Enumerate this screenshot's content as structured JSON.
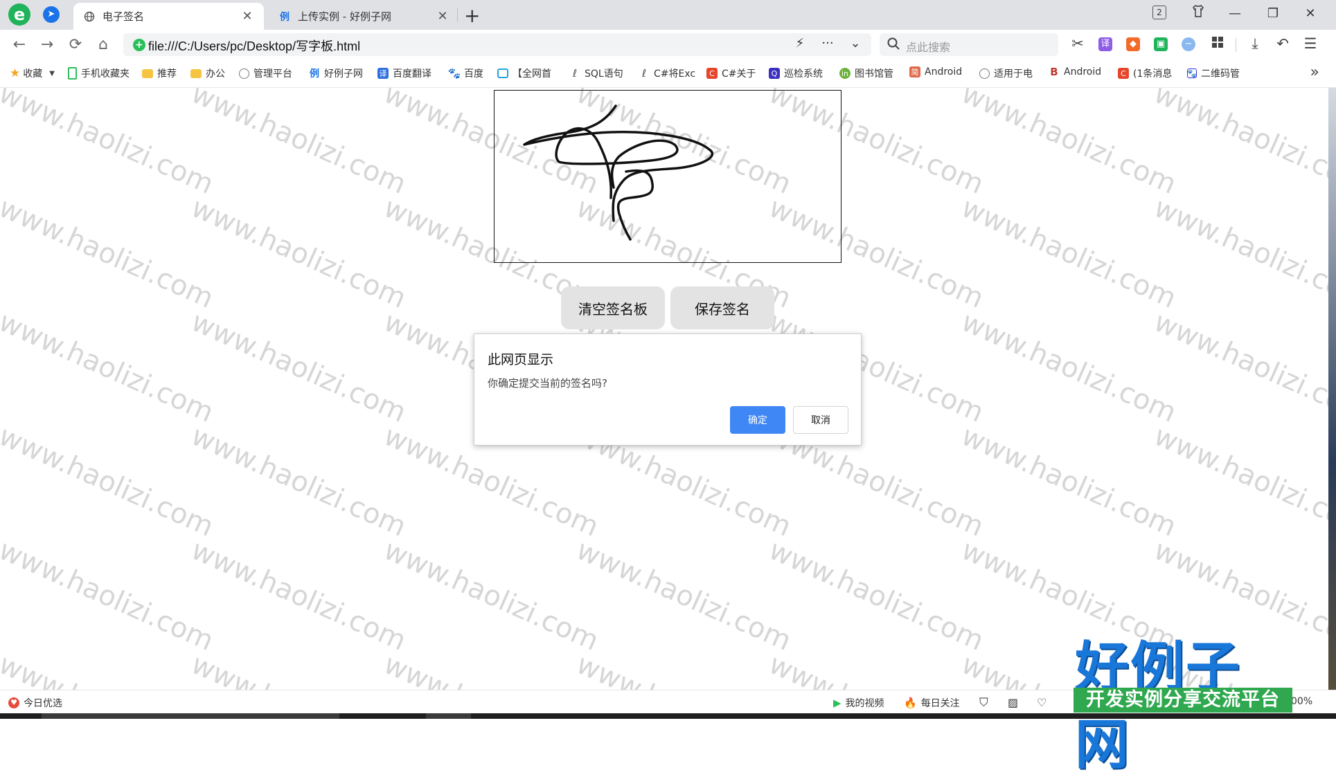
{
  "tabs": [
    {
      "title": "电子签名",
      "active": true
    },
    {
      "title": "上传实例 - 好例子网",
      "active": false,
      "favicon_text": "例"
    }
  ],
  "tab_count": "2",
  "address": {
    "url": "file:///C:/Users/pc/Desktop/写字板.html"
  },
  "search": {
    "placeholder": "点此搜索"
  },
  "bookmarks": [
    {
      "label": "收藏",
      "icon": "star-icon",
      "color": "#f5a623"
    },
    {
      "label": "手机收藏夹",
      "icon": "phone-icon",
      "color": "#2bbf5a"
    },
    {
      "label": "推荐",
      "icon": "folder-icon",
      "color": "#f5c542"
    },
    {
      "label": "办公",
      "icon": "folder-icon",
      "color": "#f5c542"
    },
    {
      "label": "管理平台",
      "icon": "globe-icon",
      "color": "#777777"
    },
    {
      "label": "好例子网",
      "icon": "haolizi-icon",
      "color": "#1a73e8"
    },
    {
      "label": "百度翻译",
      "icon": "translate-icon",
      "color": "#2f6fe0"
    },
    {
      "label": "百度",
      "icon": "paw-icon",
      "color": "#2932e1"
    },
    {
      "label": "【全网首",
      "icon": "tv-icon",
      "color": "#23a4e0"
    },
    {
      "label": "SQL语句",
      "icon": "feather-icon",
      "color": "#555555"
    },
    {
      "label": "C#将Exc",
      "icon": "feather-icon",
      "color": "#555555"
    },
    {
      "label": "C#关于",
      "icon": "csdn-icon",
      "color": "#e5452b"
    },
    {
      "label": "巡检系统",
      "icon": "q-icon",
      "color": "#3a2fbf"
    },
    {
      "label": "图书馆管",
      "icon": "in-icon",
      "color": "#6cb33e"
    },
    {
      "label": "Android",
      "icon": "jian-icon",
      "color": "#e06a4c"
    },
    {
      "label": "适用于电",
      "icon": "globe-icon",
      "color": "#777777"
    },
    {
      "label": "Android",
      "icon": "b-icon",
      "color": "#c0392b"
    },
    {
      "label": "(1条消息",
      "icon": "csdn-icon",
      "color": "#e5452b"
    },
    {
      "label": "二维码管",
      "icon": "paw-icon",
      "color": "#2932e1"
    }
  ],
  "buttons": {
    "clear": "清空签名板",
    "save": "保存签名"
  },
  "dialog": {
    "title": "此网页显示",
    "message": "你确定提交当前的签名吗?",
    "ok": "确定",
    "cancel": "取消"
  },
  "watermark_text": "www.haolizi.com",
  "status": {
    "left": "今日优选",
    "video": "我的视频",
    "follow": "每日关注",
    "zoom": "00%"
  },
  "brand": {
    "big": "好例子网",
    "small": "开发实例分享交流平台"
  }
}
